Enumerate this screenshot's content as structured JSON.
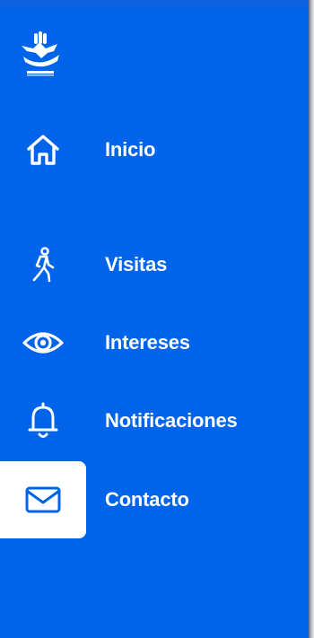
{
  "theme": {
    "sidebar_bg": "#0064ea",
    "text": "#ffffff",
    "active_bg": "#ffffff",
    "active_icon": "#0064ea"
  },
  "logo": {
    "icon": "hands-dove-logo-icon"
  },
  "nav": {
    "items": [
      {
        "id": "inicio",
        "label": "Inicio",
        "icon": "home-icon",
        "active": false
      },
      {
        "id": "visitas",
        "label": "Visitas",
        "icon": "walking-person-icon",
        "active": false
      },
      {
        "id": "intereses",
        "label": "Intereses",
        "icon": "eye-icon",
        "active": false
      },
      {
        "id": "notificaciones",
        "label": "Notificaciones",
        "icon": "bell-icon",
        "active": false
      },
      {
        "id": "contacto",
        "label": "Contacto",
        "icon": "envelope-icon",
        "active": true
      }
    ]
  }
}
